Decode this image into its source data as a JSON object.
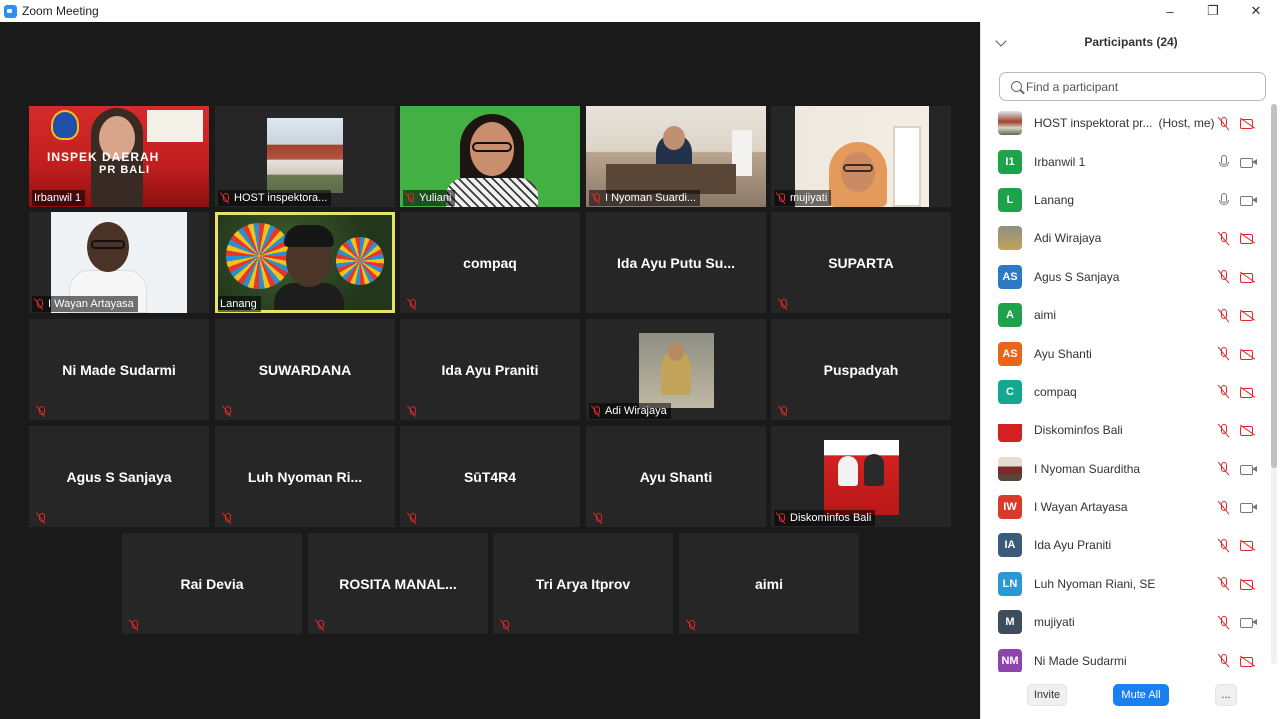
{
  "window": {
    "title": "Zoom Meeting",
    "minimize": "–",
    "restore": "❐",
    "close": "✕"
  },
  "tiles": [
    {
      "label": "Irbanwil 1",
      "video_text_1": "INSPEK      DAERAH",
      "video_text_2": "PR      BALI"
    },
    {
      "label": "HOST inspektora..."
    },
    {
      "label": "Yuliani"
    },
    {
      "label": "I Nyoman Suardi..."
    },
    {
      "label": "mujiyati"
    },
    {
      "label": "I Wayan Artayasa"
    },
    {
      "label": "Lanang"
    },
    {
      "label": "compaq"
    },
    {
      "label": "Ida Ayu Putu Su..."
    },
    {
      "label": "SUPARTA"
    },
    {
      "label": "Ni Made Sudarmi"
    },
    {
      "label": "SUWARDANA"
    },
    {
      "label": "Ida Ayu Praniti"
    },
    {
      "label": "Adi Wirajaya"
    },
    {
      "label": "Puspadyah"
    },
    {
      "label": "Agus S Sanjaya"
    },
    {
      "label": "Luh Nyoman Ri..."
    },
    {
      "label": "SūT4R4"
    },
    {
      "label": "Ayu Shanti"
    },
    {
      "label": "Diskominfos Bali"
    },
    {
      "label": "Rai Devia"
    },
    {
      "label": "ROSITA  MANAL..."
    },
    {
      "label": "Tri Arya Itprov"
    },
    {
      "label": "aimi"
    }
  ],
  "panel": {
    "title": "Participants (24)",
    "search_placeholder": "Find a participant",
    "participants": [
      {
        "name": "HOST inspektorat pr...",
        "role": "(Host, me)",
        "avatar": "",
        "color": "",
        "mic": "off",
        "cam": "off"
      },
      {
        "name": "Irbanwil 1",
        "avatar": "I1",
        "color": "#1fa34a",
        "mic": "on",
        "cam": "on"
      },
      {
        "name": "Lanang",
        "avatar": "L",
        "color": "#1fa34a",
        "mic": "on",
        "cam": "on"
      },
      {
        "name": "Adi Wirajaya",
        "avatar": "",
        "color": "",
        "mic": "off",
        "cam": "off"
      },
      {
        "name": "Agus S Sanjaya",
        "avatar": "AS",
        "color": "#2b7bc4",
        "mic": "off",
        "cam": "off"
      },
      {
        "name": "aimi",
        "avatar": "A",
        "color": "#1fa34a",
        "mic": "off",
        "cam": "off"
      },
      {
        "name": "Ayu Shanti",
        "avatar": "AS",
        "color": "#e8661c",
        "mic": "off",
        "cam": "off"
      },
      {
        "name": "compaq",
        "avatar": "C",
        "color": "#13a88f",
        "mic": "off",
        "cam": "off"
      },
      {
        "name": "Diskominfos Bali",
        "avatar": "",
        "color": "",
        "mic": "off",
        "cam": "off"
      },
      {
        "name": "I Nyoman Suarditha",
        "avatar": "",
        "color": "",
        "mic": "off",
        "cam": "on"
      },
      {
        "name": "I Wayan Artayasa",
        "avatar": "IW",
        "color": "#d93b2b",
        "mic": "off",
        "cam": "on"
      },
      {
        "name": "Ida Ayu Praniti",
        "avatar": "IA",
        "color": "#3a5b7a",
        "mic": "off",
        "cam": "off"
      },
      {
        "name": "Luh Nyoman Riani, SE",
        "avatar": "LN",
        "color": "#2b97d4",
        "mic": "off",
        "cam": "off"
      },
      {
        "name": "mujiyati",
        "avatar": "M",
        "color": "#3d4d5c",
        "mic": "off",
        "cam": "on"
      },
      {
        "name": "Ni Made Sudarmi",
        "avatar": "NM",
        "color": "#8e44ad",
        "mic": "off",
        "cam": "off"
      }
    ],
    "invite_label": "Invite",
    "mute_all_label": "Mute All",
    "more_label": "..."
  }
}
